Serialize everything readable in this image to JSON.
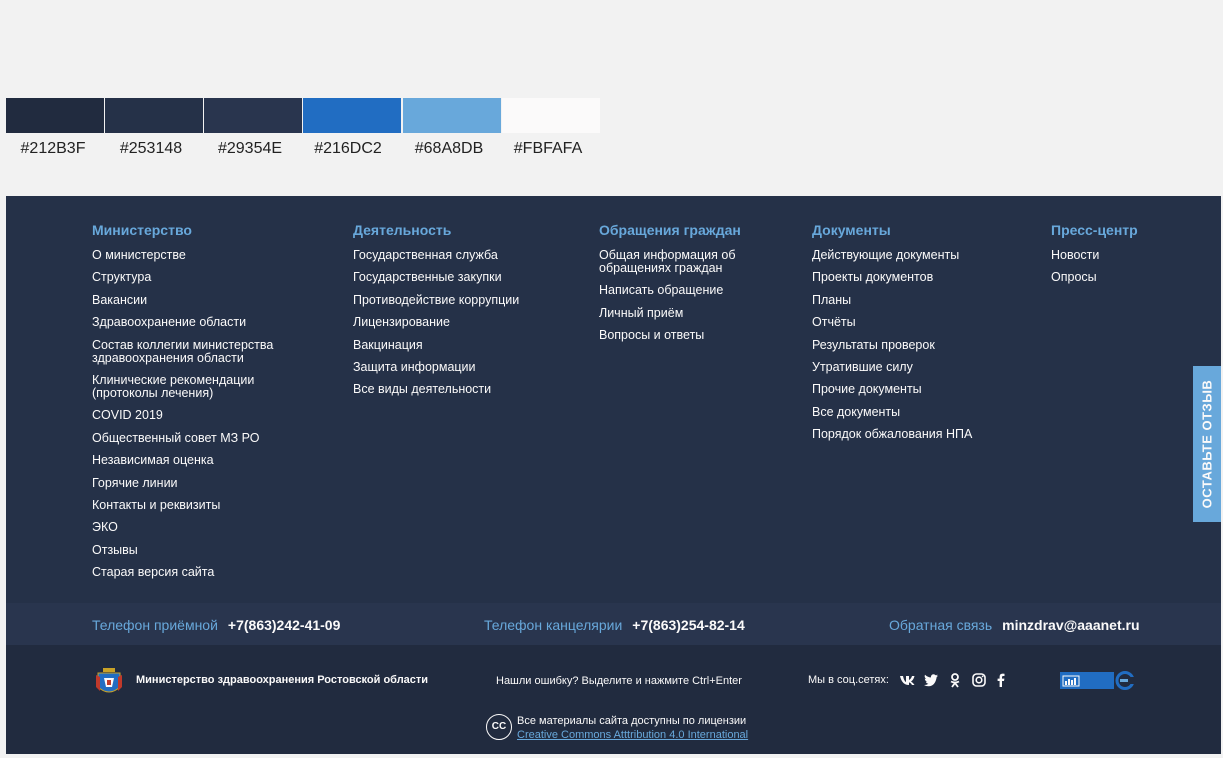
{
  "palette": [
    {
      "hex": "#212B3F",
      "label": "#212B3F"
    },
    {
      "hex": "#253148",
      "label": "#253148"
    },
    {
      "hex": "#29354E",
      "label": "#29354E"
    },
    {
      "hex": "#216DC2",
      "label": "#216DC2"
    },
    {
      "hex": "#68A8DB",
      "label": "#68A8DB"
    },
    {
      "hex": "#FBFAFA",
      "label": "#FBFAFA"
    }
  ],
  "colors": {
    "accent": "#68A8DB",
    "primary": "#216DC2",
    "text": "#FBFAFA"
  },
  "footer": {
    "columns": [
      {
        "title": "Министерство",
        "links": [
          "О министерстве",
          "Структура",
          "Вакансии",
          "Здравоохранение области",
          "Состав коллегии министерства здравоохранения области",
          "Клинические рекомендации (протоколы лечения)",
          "COVID 2019",
          "Общественный совет МЗ РО",
          "Независимая оценка",
          "Горячие линии",
          "Контакты и реквизиты",
          "ЭКО",
          "Отзывы",
          "Старая версия сайта"
        ]
      },
      {
        "title": "Деятельность",
        "links": [
          "Государственная служба",
          "Государственные закупки",
          "Противодействие коррупции",
          "Лицензирование",
          "Вакцинация",
          "Защита информации",
          "Все виды деятельности"
        ]
      },
      {
        "title": "Обращения граждан",
        "links": [
          "Общая информация об обращениях граждан",
          "Написать обращение",
          "Личный приём",
          "Вопросы и ответы"
        ]
      },
      {
        "title": "Документы",
        "links": [
          "Действующие документы",
          "Проекты документов",
          "Планы",
          "Отчёты",
          "Результаты проверок",
          "Утратившие силу",
          "Прочие документы",
          "Все документы",
          "Порядок обжалования НПА"
        ]
      },
      {
        "title": "Пресс-центр",
        "links": [
          "Новости",
          "Опросы"
        ]
      }
    ],
    "contacts": {
      "reception_label": "Телефон приёмной",
      "reception_phone": "+7(863)242-41-09",
      "office_label": "Телефон канцелярии",
      "office_phone": "+7(863)254-82-14",
      "feedback_label": "Обратная связь",
      "feedback_email": "minzdrav@aaanet.ru"
    },
    "bottom": {
      "org_name": "Министерство здравоохранения Ростовской области",
      "error_hint": "Нашли ошибку? Выделите и нажмите Ctrl+Enter",
      "social_label": "Мы в соц.сетях:",
      "social_icons": [
        "vk-icon",
        "twitter-icon",
        "odnoklassniki-icon",
        "instagram-icon",
        "facebook-icon"
      ],
      "license_text": "Все материалы сайта доступны по лицензии",
      "license_link": "Creative Commons Atttribution 4.0 International",
      "cc_label": "CC"
    }
  },
  "feedback_tab": {
    "label": "ОСТАВЬТЕ ОТЗЫВ"
  }
}
